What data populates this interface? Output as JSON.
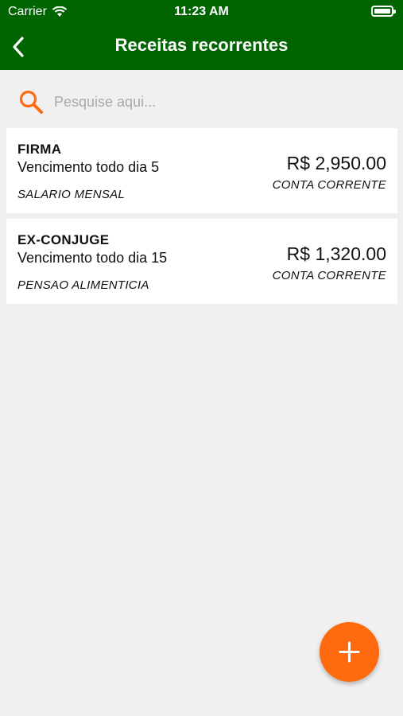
{
  "status_bar": {
    "carrier": "Carrier",
    "time": "11:23 AM"
  },
  "header": {
    "title": "Receitas recorrentes"
  },
  "search": {
    "placeholder": "Pesquise aqui..."
  },
  "items": [
    {
      "name": "FIRMA",
      "due": "Vencimento todo dia 5",
      "description": "SALARIO MENSAL",
      "value": "R$ 2,950.00",
      "account": "CONTA CORRENTE"
    },
    {
      "name": "EX-CONJUGE",
      "due": "Vencimento todo dia 15",
      "description": "PENSAO ALIMENTICIA",
      "value": "R$ 1,320.00",
      "account": "CONTA CORRENTE"
    }
  ],
  "icons": {
    "back": "chevron-left-icon",
    "search": "search-icon",
    "add": "plus-icon"
  },
  "colors": {
    "header_bg": "#006400",
    "accent": "#ff6a0f",
    "background": "#f0f0f0"
  }
}
